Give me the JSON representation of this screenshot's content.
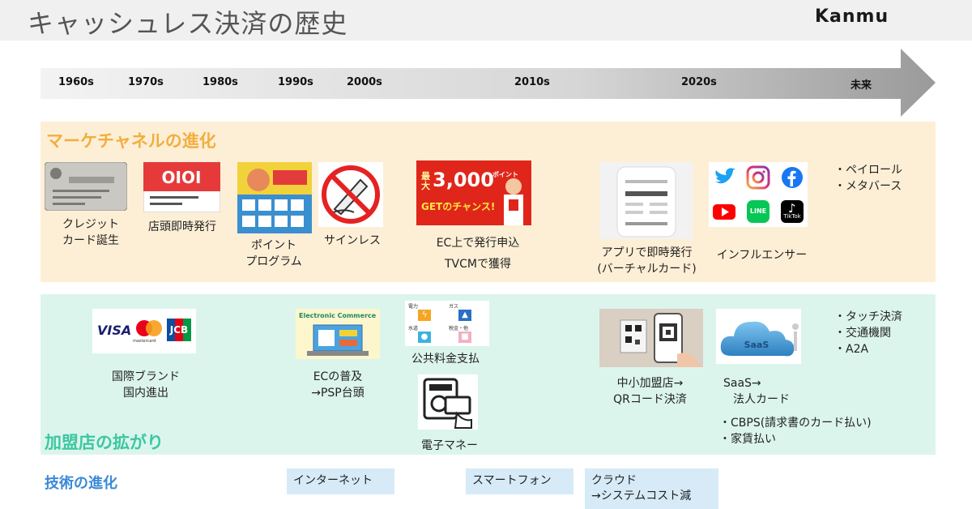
{
  "header": {
    "title": "キャッシュレス決済の歴史",
    "brand": "Kanmu"
  },
  "timeline": {
    "decades": [
      "1960s",
      "1970s",
      "1980s",
      "1990s",
      "2000s",
      "2010s",
      "2020s",
      "未来"
    ]
  },
  "marketing": {
    "title": "マーケチャネルの進化",
    "items": [
      {
        "lines": [
          "クレジット",
          "カード誕生"
        ]
      },
      {
        "lines": [
          "店頭即時発行"
        ]
      },
      {
        "lines": [
          "ポイント",
          "プログラム"
        ]
      },
      {
        "lines": [
          "サインレス"
        ]
      },
      {
        "lines": [
          "EC上で発行申込",
          "TVCMで獲得"
        ]
      },
      {
        "lines": [
          "アプリで即時発行",
          "(バーチャルカード)"
        ]
      },
      {
        "lines": [
          "インフルエンサー"
        ]
      }
    ],
    "future": [
      "・ペイロール",
      "・メタバース"
    ],
    "card_ad": {
      "prefix": "最大",
      "amount": "3,000",
      "suffix": "ポイント",
      "tagline": "GETのチャンス!"
    },
    "shop_logo": "OIOI",
    "sns_labels": {
      "tiktok": "TikTok",
      "line": "LINE"
    }
  },
  "merchant": {
    "title": "加盟店の拡がり",
    "items": [
      {
        "lines": [
          "国際ブランド",
          "国内進出"
        ]
      },
      {
        "lines": [
          "ECの普及",
          "→PSP台頭"
        ]
      },
      {
        "lines": [
          "公共料金支払"
        ]
      },
      {
        "lines": [
          "電子マネー"
        ]
      },
      {
        "lines": [
          "中小加盟店→",
          "QRコード決済"
        ]
      },
      {
        "lines": [
          "SaaS→",
          "法人カード"
        ]
      }
    ],
    "future": [
      "・タッチ決済",
      "・交通機関",
      "・A2A"
    ],
    "extra": [
      "・CBPS(請求書のカード払い)",
      "・家賃払い"
    ],
    "brands": {
      "visa": "VISA",
      "jcb": "JCB",
      "mc": "mastercard"
    },
    "ec_banner": "Electronic Commerce",
    "utilities": [
      "電力",
      "ガス",
      "水道",
      "税金・他"
    ],
    "saas": "SaaS"
  },
  "tech": {
    "title": "技術の進化",
    "boxes": [
      {
        "lines": [
          "インターネット"
        ]
      },
      {
        "lines": [
          "スマートフォン"
        ]
      },
      {
        "lines": [
          "クラウド",
          "→システムコスト減"
        ]
      }
    ]
  },
  "colors": {
    "marketing_band": "#fdefd6",
    "merchant_band": "#dcf5ec",
    "marketing_title": "#f2ae3f",
    "merchant_title": "#3cc7a2",
    "tech_title": "#3b8ad8",
    "tech_box": "#d6ebf7"
  }
}
